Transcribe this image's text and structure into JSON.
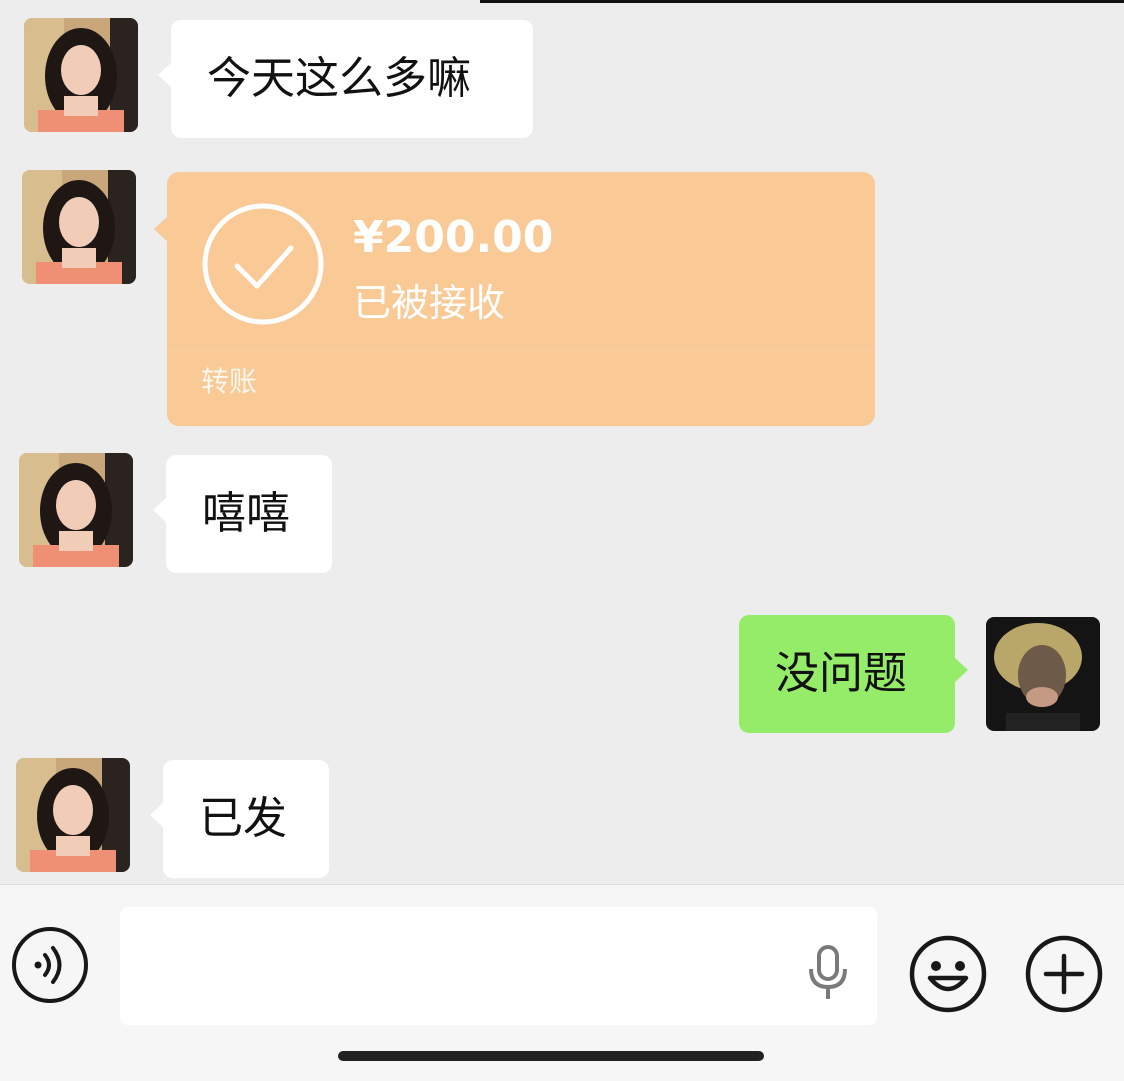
{
  "messages": [
    {
      "side": "left",
      "type": "text",
      "text": "今天这么多嘛"
    },
    {
      "side": "left",
      "type": "transfer",
      "amount": "¥200.00",
      "status": "已被接收",
      "label": "转账"
    },
    {
      "side": "left",
      "type": "text",
      "text": "嘻嘻"
    },
    {
      "side": "right",
      "type": "text",
      "text": "没问题"
    },
    {
      "side": "left",
      "type": "text",
      "text": "已发"
    }
  ],
  "input_bar": {
    "voice_icon": "voice-icon",
    "mic_icon": "microphone-icon",
    "emoji_icon": "emoji-icon",
    "add_icon": "plus-icon"
  },
  "colors": {
    "background": "#ededed",
    "incoming_bubble": "#ffffff",
    "outgoing_bubble": "#95ec69",
    "transfer_card": "#f9c996"
  }
}
